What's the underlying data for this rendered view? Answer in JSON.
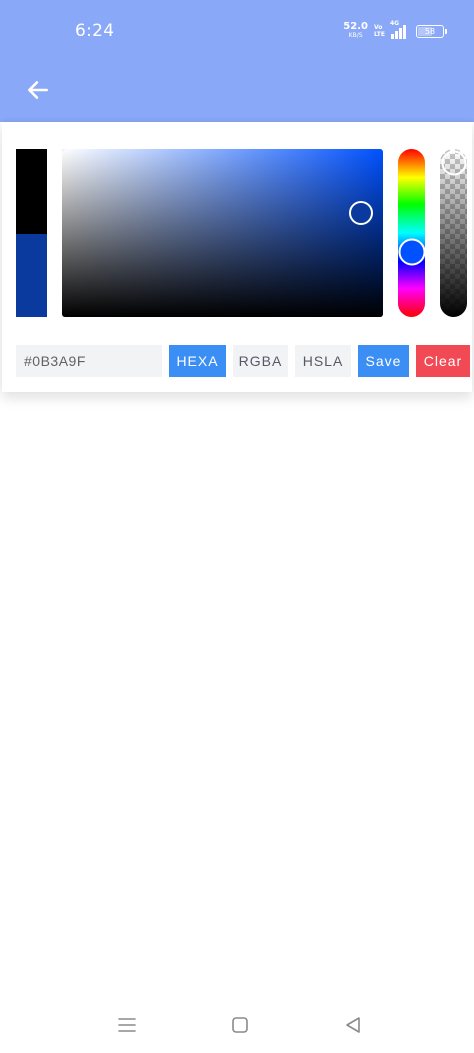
{
  "status_bar": {
    "time": "6:24",
    "net_speed_value": "52.0",
    "net_speed_unit": "KB/S",
    "volte_top": "Vo",
    "volte_bottom": "LTE",
    "signal_label": "4G",
    "battery": "58",
    "battery_level": 0.58
  },
  "app_bar": {
    "back_icon": "arrow-left-icon"
  },
  "color_picker": {
    "current_color": "#0B3A9F",
    "previous_color": "#000000",
    "hue_degrees": 221,
    "saturation": 0.93,
    "value": 0.62,
    "alpha": 1,
    "hex_value": "#0B3A9F",
    "modes": {
      "hexa": "HEXA",
      "rgba": "RGBA",
      "hsla": "HSLA"
    },
    "active_mode": "HEXA",
    "save_label": "Save",
    "clear_label": "Clear"
  },
  "colors": {
    "header": "#8aa8f8",
    "primary_button": "#3b8ef3",
    "danger_button": "#f24a55",
    "inactive_button": "#f2f3f5"
  },
  "nav_bar": {
    "icons": [
      "menu-icon",
      "home-square-icon",
      "back-triangle-icon"
    ]
  }
}
